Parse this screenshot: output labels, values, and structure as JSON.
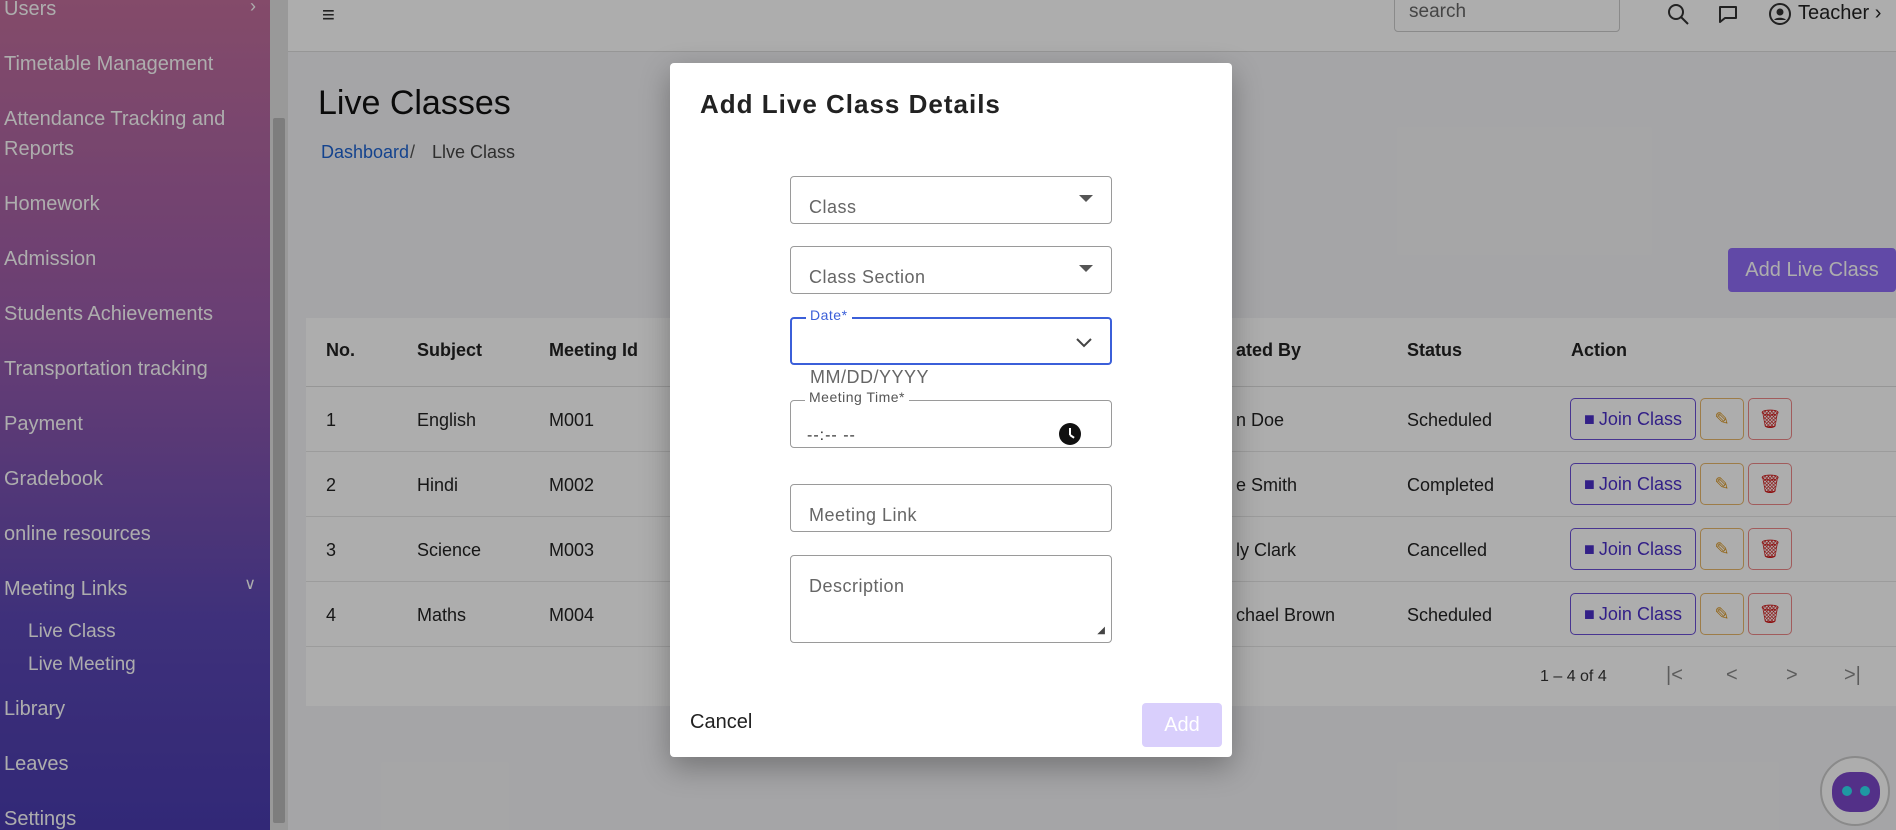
{
  "sidebar": {
    "items": [
      {
        "label": "Users"
      },
      {
        "label": "Timetable Management"
      },
      {
        "label": "Attendance Tracking and"
      },
      {
        "label": "Reports"
      },
      {
        "label": "Homework"
      },
      {
        "label": "Admission"
      },
      {
        "label": "Students Achievements"
      },
      {
        "label": "Transportation tracking"
      },
      {
        "label": "Payment"
      },
      {
        "label": "Gradebook"
      },
      {
        "label": "online resources"
      },
      {
        "label": "Meeting Links"
      },
      {
        "label": "Library"
      },
      {
        "label": "Leaves"
      },
      {
        "label": "Settings"
      }
    ],
    "subitems": [
      {
        "label": "Live Class"
      },
      {
        "label": "Live Meeting"
      }
    ]
  },
  "topbar": {
    "search_placeholder": "search",
    "user_label": "Teacher"
  },
  "page": {
    "title": "Live Classes",
    "breadcrumb_home": "Dashboard",
    "breadcrumb_sep": "/",
    "breadcrumb_current": "Llve Class",
    "add_button": "Add Live Class"
  },
  "table": {
    "headers": [
      "No.",
      "Subject",
      "Meeting Id",
      "ated By",
      "Status",
      "Action"
    ],
    "rows": [
      {
        "no": "1",
        "subject": "English",
        "meeting_id": "M001",
        "created_by": "n Doe",
        "status": "Scheduled"
      },
      {
        "no": "2",
        "subject": "Hindi",
        "meeting_id": "M002",
        "created_by": "e Smith",
        "status": "Completed"
      },
      {
        "no": "3",
        "subject": "Science",
        "meeting_id": "M003",
        "created_by": "ly Clark",
        "status": "Cancelled"
      },
      {
        "no": "4",
        "subject": "Maths",
        "meeting_id": "M004",
        "created_by": "chael Brown",
        "status": "Scheduled"
      }
    ],
    "join_label": "Join Class",
    "pagination_text": "1 – 4 of 4"
  },
  "modal": {
    "title": "Add Live Class Details",
    "class_label": "Class",
    "section_label": "Class Section",
    "date_label": "Date*",
    "date_format": "MM/DD/YYYY",
    "time_label": "Meeting Time*",
    "time_value": "--:-- --",
    "link_label": "Meeting Link",
    "description_label": "Description",
    "cancel_label": "Cancel",
    "add_label": "Add"
  }
}
